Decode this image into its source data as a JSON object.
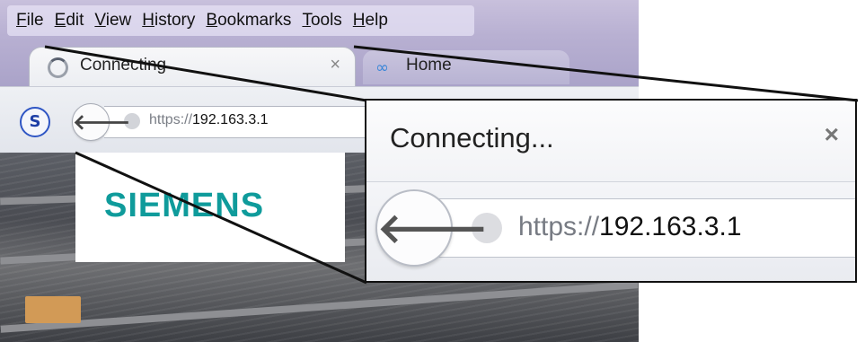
{
  "menubar": {
    "items": [
      "File",
      "Edit",
      "View",
      "History",
      "Bookmarks",
      "Tools",
      "Help"
    ]
  },
  "tabs": {
    "active": {
      "title": "Connecting",
      "close": "×"
    },
    "second": {
      "title": "Home"
    }
  },
  "navbar": {
    "logo_letter": "S",
    "back_symbol": "🡐",
    "url_scheme": "https://",
    "url_host": "192.163.3.1"
  },
  "page": {
    "brand": "SIEMENS"
  },
  "zoom": {
    "tab_title": "Connecting...",
    "close": "×",
    "back_symbol": "🡐",
    "url_scheme": "https://",
    "url_host": "192.163.3.1"
  },
  "colors": {
    "brand_teal": "#0f9b9b",
    "home_icon_blue": "#3a86d8"
  },
  "icons": {
    "tab_loading": "spinner-icon",
    "home_tab": "infinity-icon",
    "back": "back-arrow-icon",
    "site_identity": "globe-icon",
    "extension": "s-logo-icon",
    "close": "close-icon"
  }
}
